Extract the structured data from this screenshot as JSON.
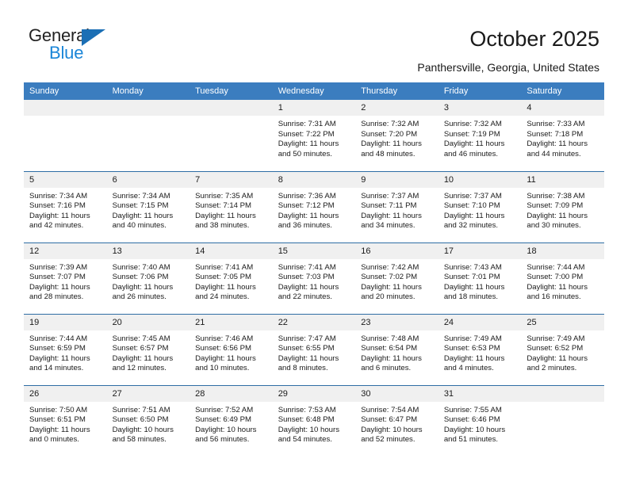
{
  "logo": {
    "word1": "General",
    "word2": "Blue",
    "triangle_color": "#1b6fb5",
    "word2_color": "#1b86d8"
  },
  "header": {
    "title": "October 2025",
    "subtitle": "Panthersville, Georgia, United States"
  },
  "theme": {
    "header_band": "#3b7dbf",
    "row_rule": "#2e6da4",
    "daynum_band": "#f0f0f0"
  },
  "calendar": {
    "weekday_headers": [
      "Sunday",
      "Monday",
      "Tuesday",
      "Wednesday",
      "Thursday",
      "Friday",
      "Saturday"
    ],
    "weeks": [
      [
        {
          "day": "",
          "lines": []
        },
        {
          "day": "",
          "lines": []
        },
        {
          "day": "",
          "lines": []
        },
        {
          "day": "1",
          "lines": [
            "Sunrise: 7:31 AM",
            "Sunset: 7:22 PM",
            "Daylight: 11 hours",
            "and 50 minutes."
          ]
        },
        {
          "day": "2",
          "lines": [
            "Sunrise: 7:32 AM",
            "Sunset: 7:20 PM",
            "Daylight: 11 hours",
            "and 48 minutes."
          ]
        },
        {
          "day": "3",
          "lines": [
            "Sunrise: 7:32 AM",
            "Sunset: 7:19 PM",
            "Daylight: 11 hours",
            "and 46 minutes."
          ]
        },
        {
          "day": "4",
          "lines": [
            "Sunrise: 7:33 AM",
            "Sunset: 7:18 PM",
            "Daylight: 11 hours",
            "and 44 minutes."
          ]
        }
      ],
      [
        {
          "day": "5",
          "lines": [
            "Sunrise: 7:34 AM",
            "Sunset: 7:16 PM",
            "Daylight: 11 hours",
            "and 42 minutes."
          ]
        },
        {
          "day": "6",
          "lines": [
            "Sunrise: 7:34 AM",
            "Sunset: 7:15 PM",
            "Daylight: 11 hours",
            "and 40 minutes."
          ]
        },
        {
          "day": "7",
          "lines": [
            "Sunrise: 7:35 AM",
            "Sunset: 7:14 PM",
            "Daylight: 11 hours",
            "and 38 minutes."
          ]
        },
        {
          "day": "8",
          "lines": [
            "Sunrise: 7:36 AM",
            "Sunset: 7:12 PM",
            "Daylight: 11 hours",
            "and 36 minutes."
          ]
        },
        {
          "day": "9",
          "lines": [
            "Sunrise: 7:37 AM",
            "Sunset: 7:11 PM",
            "Daylight: 11 hours",
            "and 34 minutes."
          ]
        },
        {
          "day": "10",
          "lines": [
            "Sunrise: 7:37 AM",
            "Sunset: 7:10 PM",
            "Daylight: 11 hours",
            "and 32 minutes."
          ]
        },
        {
          "day": "11",
          "lines": [
            "Sunrise: 7:38 AM",
            "Sunset: 7:09 PM",
            "Daylight: 11 hours",
            "and 30 minutes."
          ]
        }
      ],
      [
        {
          "day": "12",
          "lines": [
            "Sunrise: 7:39 AM",
            "Sunset: 7:07 PM",
            "Daylight: 11 hours",
            "and 28 minutes."
          ]
        },
        {
          "day": "13",
          "lines": [
            "Sunrise: 7:40 AM",
            "Sunset: 7:06 PM",
            "Daylight: 11 hours",
            "and 26 minutes."
          ]
        },
        {
          "day": "14",
          "lines": [
            "Sunrise: 7:41 AM",
            "Sunset: 7:05 PM",
            "Daylight: 11 hours",
            "and 24 minutes."
          ]
        },
        {
          "day": "15",
          "lines": [
            "Sunrise: 7:41 AM",
            "Sunset: 7:03 PM",
            "Daylight: 11 hours",
            "and 22 minutes."
          ]
        },
        {
          "day": "16",
          "lines": [
            "Sunrise: 7:42 AM",
            "Sunset: 7:02 PM",
            "Daylight: 11 hours",
            "and 20 minutes."
          ]
        },
        {
          "day": "17",
          "lines": [
            "Sunrise: 7:43 AM",
            "Sunset: 7:01 PM",
            "Daylight: 11 hours",
            "and 18 minutes."
          ]
        },
        {
          "day": "18",
          "lines": [
            "Sunrise: 7:44 AM",
            "Sunset: 7:00 PM",
            "Daylight: 11 hours",
            "and 16 minutes."
          ]
        }
      ],
      [
        {
          "day": "19",
          "lines": [
            "Sunrise: 7:44 AM",
            "Sunset: 6:59 PM",
            "Daylight: 11 hours",
            "and 14 minutes."
          ]
        },
        {
          "day": "20",
          "lines": [
            "Sunrise: 7:45 AM",
            "Sunset: 6:57 PM",
            "Daylight: 11 hours",
            "and 12 minutes."
          ]
        },
        {
          "day": "21",
          "lines": [
            "Sunrise: 7:46 AM",
            "Sunset: 6:56 PM",
            "Daylight: 11 hours",
            "and 10 minutes."
          ]
        },
        {
          "day": "22",
          "lines": [
            "Sunrise: 7:47 AM",
            "Sunset: 6:55 PM",
            "Daylight: 11 hours",
            "and 8 minutes."
          ]
        },
        {
          "day": "23",
          "lines": [
            "Sunrise: 7:48 AM",
            "Sunset: 6:54 PM",
            "Daylight: 11 hours",
            "and 6 minutes."
          ]
        },
        {
          "day": "24",
          "lines": [
            "Sunrise: 7:49 AM",
            "Sunset: 6:53 PM",
            "Daylight: 11 hours",
            "and 4 minutes."
          ]
        },
        {
          "day": "25",
          "lines": [
            "Sunrise: 7:49 AM",
            "Sunset: 6:52 PM",
            "Daylight: 11 hours",
            "and 2 minutes."
          ]
        }
      ],
      [
        {
          "day": "26",
          "lines": [
            "Sunrise: 7:50 AM",
            "Sunset: 6:51 PM",
            "Daylight: 11 hours",
            "and 0 minutes."
          ]
        },
        {
          "day": "27",
          "lines": [
            "Sunrise: 7:51 AM",
            "Sunset: 6:50 PM",
            "Daylight: 10 hours",
            "and 58 minutes."
          ]
        },
        {
          "day": "28",
          "lines": [
            "Sunrise: 7:52 AM",
            "Sunset: 6:49 PM",
            "Daylight: 10 hours",
            "and 56 minutes."
          ]
        },
        {
          "day": "29",
          "lines": [
            "Sunrise: 7:53 AM",
            "Sunset: 6:48 PM",
            "Daylight: 10 hours",
            "and 54 minutes."
          ]
        },
        {
          "day": "30",
          "lines": [
            "Sunrise: 7:54 AM",
            "Sunset: 6:47 PM",
            "Daylight: 10 hours",
            "and 52 minutes."
          ]
        },
        {
          "day": "31",
          "lines": [
            "Sunrise: 7:55 AM",
            "Sunset: 6:46 PM",
            "Daylight: 10 hours",
            "and 51 minutes."
          ]
        },
        {
          "day": "",
          "lines": []
        }
      ]
    ]
  }
}
